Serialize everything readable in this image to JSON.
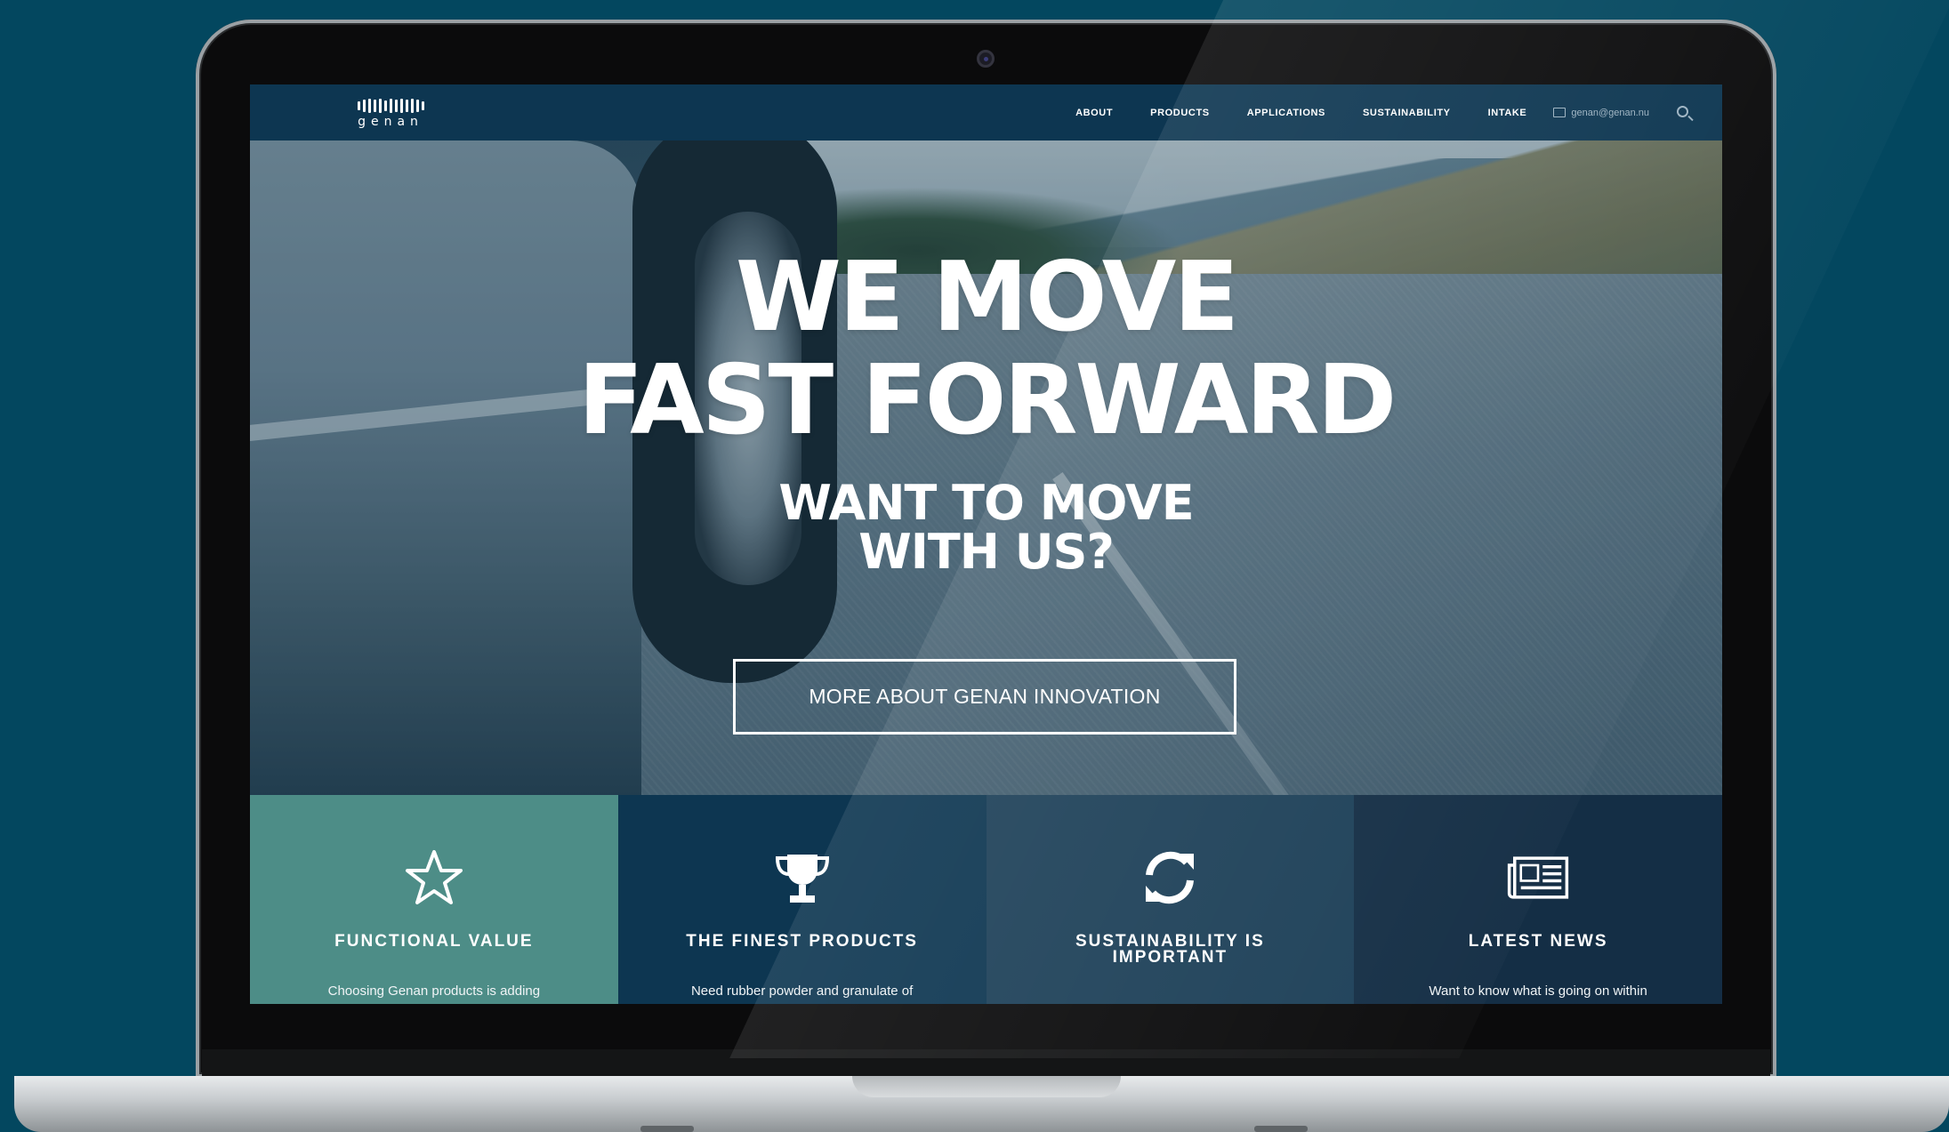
{
  "colors": {
    "background": "#03475f",
    "navbar": "#0d3651",
    "feature_teal": "#4d8d87",
    "feature_navy": "#0d3651",
    "feature_slate": "#1d4058",
    "feature_dark": "#142e45"
  },
  "brand": {
    "logo_text": "genan"
  },
  "nav": {
    "items": [
      "ABOUT",
      "PRODUCTS",
      "APPLICATIONS",
      "SUSTAINABILITY",
      "INTAKE"
    ],
    "email": "genan@genan.nu",
    "search_icon": "search-icon",
    "mail_icon": "mail-icon"
  },
  "hero": {
    "title_line1": "WE MOVE",
    "title_line2": "FAST FORWARD",
    "subtitle_line1": "WANT TO MOVE",
    "subtitle_line2": "WITH US?",
    "cta_label": "MORE ABOUT GENAN INNOVATION"
  },
  "features": [
    {
      "icon": "star-icon",
      "title": "FUNCTIONAL VALUE",
      "text": "Choosing Genan products is adding"
    },
    {
      "icon": "trophy-icon",
      "title": "THE FINEST PRODUCTS",
      "text": "Need rubber powder and granulate of"
    },
    {
      "icon": "refresh-icon",
      "title_line1": "SUSTAINABILITY IS",
      "title_line2": "IMPORTANT"
    },
    {
      "icon": "newspaper-icon",
      "title": "LATEST NEWS",
      "text": "Want to know what is going on within"
    }
  ]
}
